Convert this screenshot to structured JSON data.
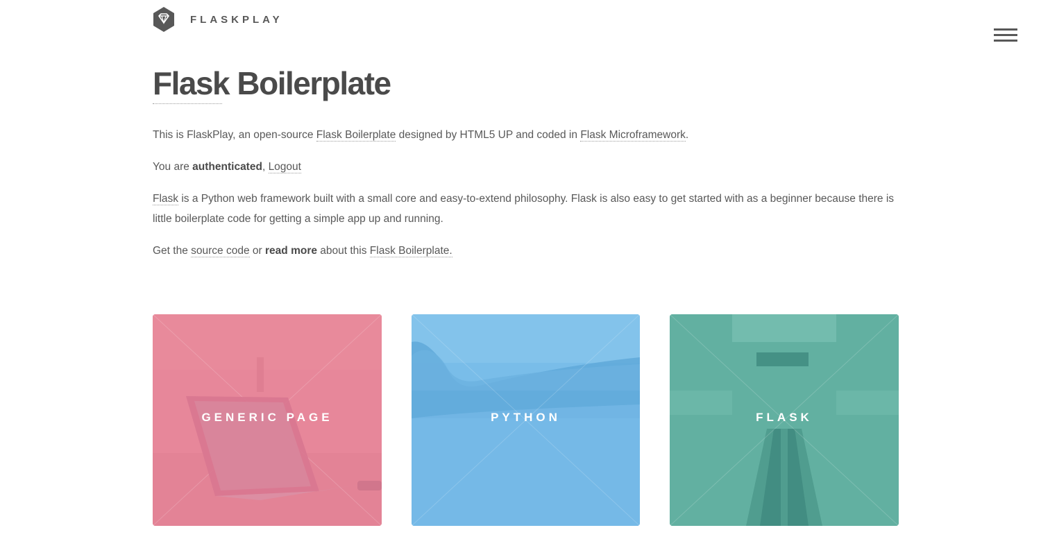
{
  "header": {
    "logo_icon": "diamond-icon",
    "brand": "FLASKPLAY",
    "menu_icon": "hamburger-menu-icon"
  },
  "main": {
    "title": "Flask Boilerplate",
    "intro": {
      "t1": "This is FlaskPlay, an open-source ",
      "link1": "Flask Boilerplate",
      "t2": " designed by HTML5 UP and coded in ",
      "link2": "Flask Microframework",
      "t3": "."
    },
    "auth": {
      "t1": "You are ",
      "status": "authenticated",
      "t2": ", ",
      "logout": "Logout"
    },
    "description": {
      "link": "Flask",
      "text": " is a Python web framework built with a small core and easy-to-extend philosophy. Flask is also easy to get started with as a beginner because there is little boilerplate code for getting a simple app up and running."
    },
    "source": {
      "t1": "Get the ",
      "link1": "source code",
      "t2": " or ",
      "bold": "read more",
      "t3": " about this ",
      "link2": "Flask Boilerplate."
    }
  },
  "tiles": [
    {
      "label": "GENERIC PAGE",
      "color": "#e7879a"
    },
    {
      "label": "PYTHON",
      "color": "#79bde9"
    },
    {
      "label": "FLASK",
      "color": "#62b0a1"
    }
  ]
}
